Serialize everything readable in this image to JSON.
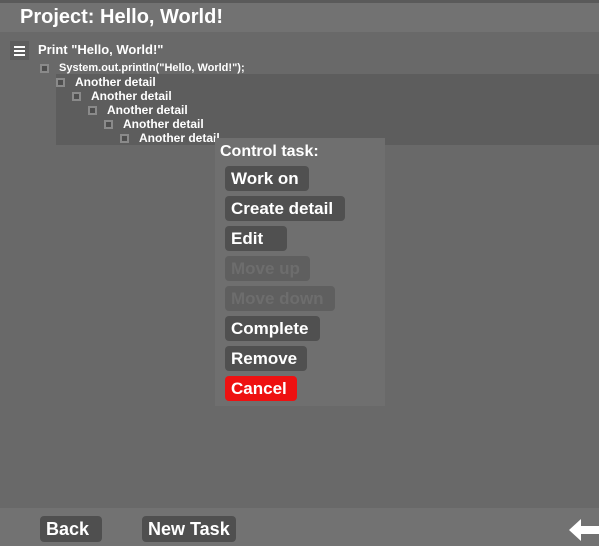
{
  "header": {
    "title": "Project: Hello, World!"
  },
  "menu_icon": "hamburger-menu-icon",
  "task": {
    "title": "Print \"Hello, World!\"",
    "details": [
      "System.out.println(\"Hello, World!\");",
      "Another detail",
      "Another detail",
      "Another detail",
      "Another detail",
      "Another detail"
    ]
  },
  "control_menu": {
    "title": "Control task:",
    "items": [
      {
        "label": "Work on",
        "state": "enabled"
      },
      {
        "label": "Create detail",
        "state": "enabled"
      },
      {
        "label": "Edit",
        "state": "enabled"
      },
      {
        "label": "Move up",
        "state": "disabled"
      },
      {
        "label": "Move down",
        "state": "disabled"
      },
      {
        "label": "Complete",
        "state": "enabled"
      },
      {
        "label": "Remove",
        "state": "enabled"
      },
      {
        "label": "Cancel",
        "state": "danger"
      }
    ]
  },
  "footer": {
    "back_label": "Back",
    "new_task_label": "New Task",
    "back_arrow_icon": "arrow-left-icon"
  },
  "colors": {
    "background": "#696969",
    "danger": "#ee1111",
    "button": "#505050",
    "text": "#ffffff"
  }
}
